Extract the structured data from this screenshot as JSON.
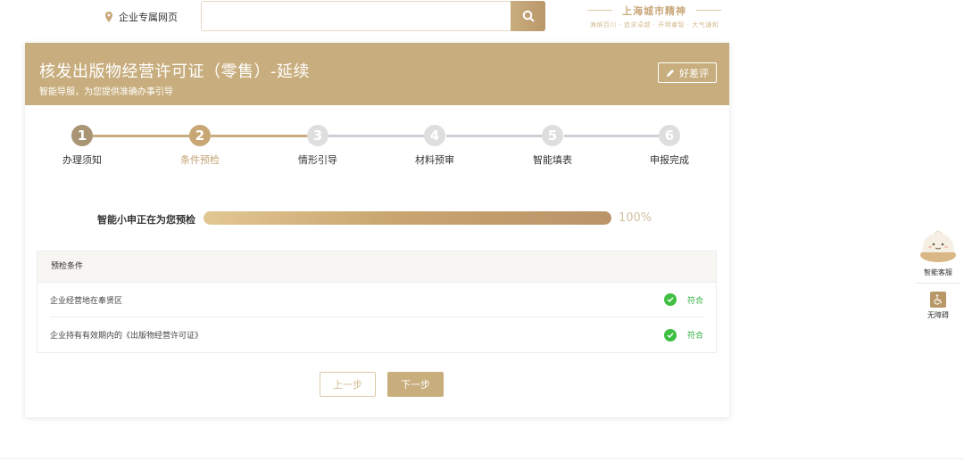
{
  "header": {
    "location_label": "企业专属网页",
    "search_placeholder": "",
    "brand_title": "上海城市精神",
    "brand_subtitle": "海纳百川 · 追求卓越 · 开明睿智 · 大气谦和"
  },
  "card": {
    "title": "核发出版物经营许可证（零售）-延续",
    "subtitle": "智能导服，为您提供准确办事引导",
    "review_label": "好差评"
  },
  "steps": [
    {
      "num": "1",
      "label": "办理须知",
      "state": "done"
    },
    {
      "num": "2",
      "label": "条件预检",
      "state": "active"
    },
    {
      "num": "3",
      "label": "情形引导",
      "state": "todo"
    },
    {
      "num": "4",
      "label": "材料预审",
      "state": "todo"
    },
    {
      "num": "5",
      "label": "智能填表",
      "state": "todo"
    },
    {
      "num": "6",
      "label": "申报完成",
      "state": "todo"
    }
  ],
  "progress": {
    "label": "智能小申正在为您预检",
    "percent_text": "100%",
    "value": 100
  },
  "precheck": {
    "header": "预检条件",
    "rows": [
      {
        "condition": "企业经营地在奉贤区",
        "status": "符合"
      },
      {
        "condition": "企业持有有效期内的《出版物经营许可证》",
        "status": "符合"
      }
    ]
  },
  "buttons": {
    "prev_label": "上一步",
    "next_label": "下一步"
  },
  "float_panel": {
    "service_label": "智能客服",
    "access_label": "无障碍"
  },
  "colors": {
    "accent": "#c8ae7e",
    "success": "#3fbf42"
  }
}
